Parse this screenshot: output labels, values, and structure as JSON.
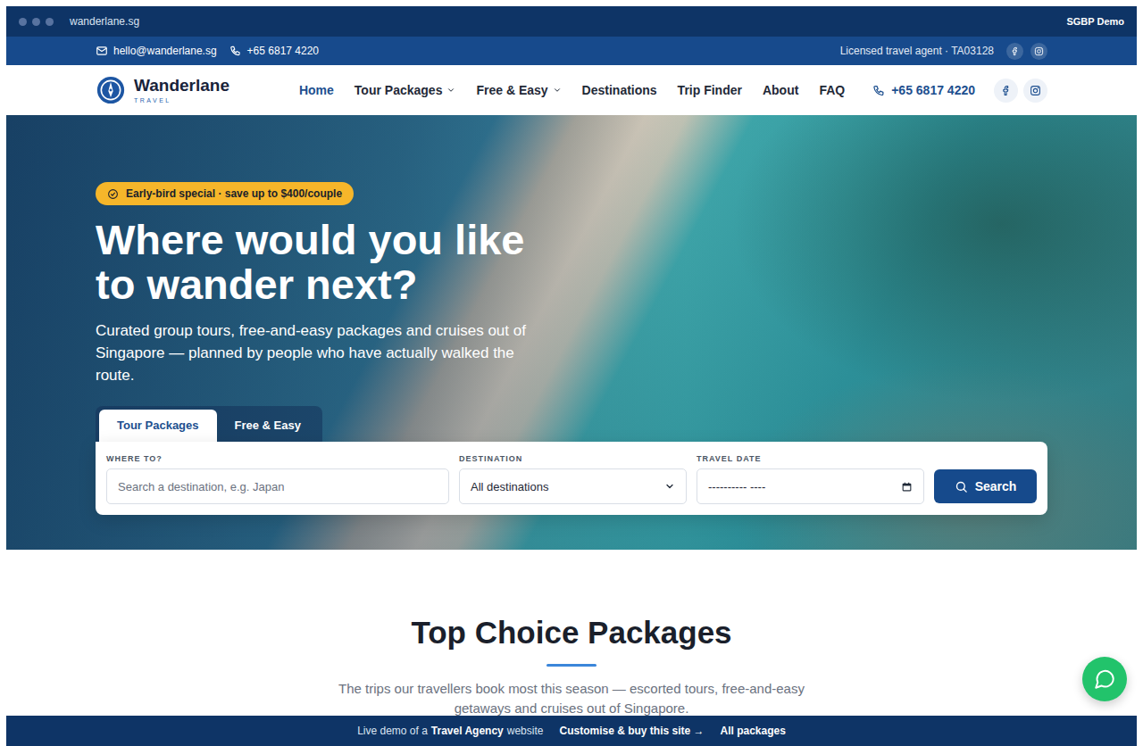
{
  "browser": {
    "url": "wanderlane.sg",
    "label": "SGBP Demo"
  },
  "topbar": {
    "email": "hello@wanderlane.sg",
    "phone": "+65 6817 4220",
    "license": "Licensed travel agent · TA03128"
  },
  "logo": {
    "name": "Wanderlane",
    "tagline": "TRAVEL"
  },
  "nav": {
    "items": [
      {
        "label": "Home",
        "selected": true,
        "dropdown": false
      },
      {
        "label": "Tour Packages",
        "selected": false,
        "dropdown": true
      },
      {
        "label": "Free & Easy",
        "selected": false,
        "dropdown": true
      },
      {
        "label": "Destinations",
        "selected": false,
        "dropdown": false
      },
      {
        "label": "Trip Finder",
        "selected": false,
        "dropdown": false
      },
      {
        "label": "About",
        "selected": false,
        "dropdown": false
      },
      {
        "label": "FAQ",
        "selected": false,
        "dropdown": false
      }
    ],
    "phone": "+65 6817 4220"
  },
  "hero": {
    "badge": "Early-bird special · save up to $400/couple",
    "title_lines": [
      "Where would you like",
      "to wander next?"
    ],
    "subtitle": "Curated group tours, free-and-easy packages and cruises out of Singapore — planned by people who have actually walked the route.",
    "tabs": [
      {
        "label": "Tour Packages",
        "selected": true
      },
      {
        "label": "Free & Easy",
        "selected": false
      }
    ],
    "search": {
      "fields": [
        {
          "label": "WHERE TO?",
          "kind": "text",
          "placeholder": "Search a destination, e.g. Japan"
        },
        {
          "label": "DESTINATION",
          "kind": "select",
          "value": "All destinations"
        },
        {
          "label": "TRAVEL DATE",
          "kind": "date",
          "value": "---------- ----"
        }
      ],
      "button": "Search"
    }
  },
  "section": {
    "title": "Top Choice Packages",
    "subtitle": "The trips our travellers book most this season — escorted tours, free-and-easy getaways and cruises out of Singapore."
  },
  "footer_bar": {
    "prefix": "Live demo of a",
    "highlight": "Travel Agency",
    "suffix": "website",
    "cta": "Customise & buy this site →",
    "link": "All packages"
  }
}
